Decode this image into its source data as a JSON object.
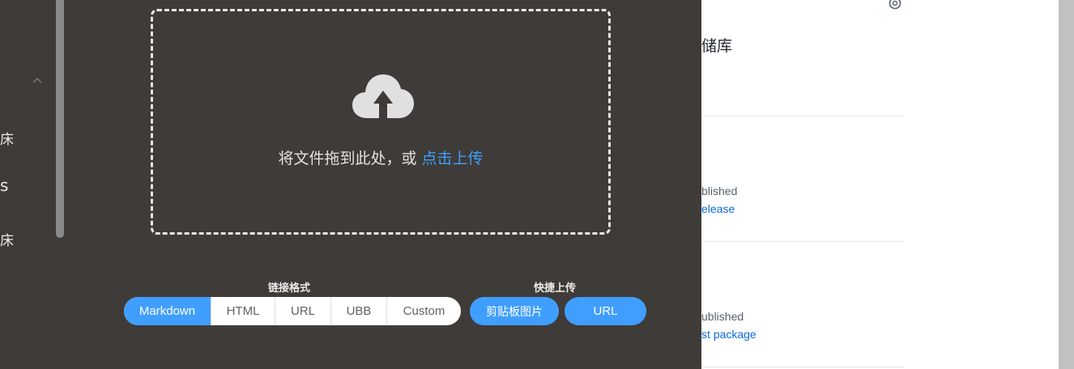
{
  "sidebar": {
    "text_1": "床",
    "text_2": "s",
    "text_3": "床"
  },
  "upload": {
    "drop_text": "将文件拖到此处，或",
    "drop_link": "点击上传"
  },
  "link_format": {
    "label": "链接格式",
    "options": [
      "Markdown",
      "HTML",
      "URL",
      "UBB",
      "Custom"
    ],
    "selected": "Markdown"
  },
  "quick_upload": {
    "label": "快捷上传",
    "clipboard_button": "剪贴板图片",
    "url_button": "URL"
  },
  "background_page": {
    "repo_title": "储库",
    "item_1_status": "blished",
    "item_1_link": "elease",
    "item_2_status": "ublished",
    "item_2_link": "st package"
  },
  "colors": {
    "panel_bg": "#3e3b38",
    "accent": "#409eff",
    "link": "#0969da"
  }
}
